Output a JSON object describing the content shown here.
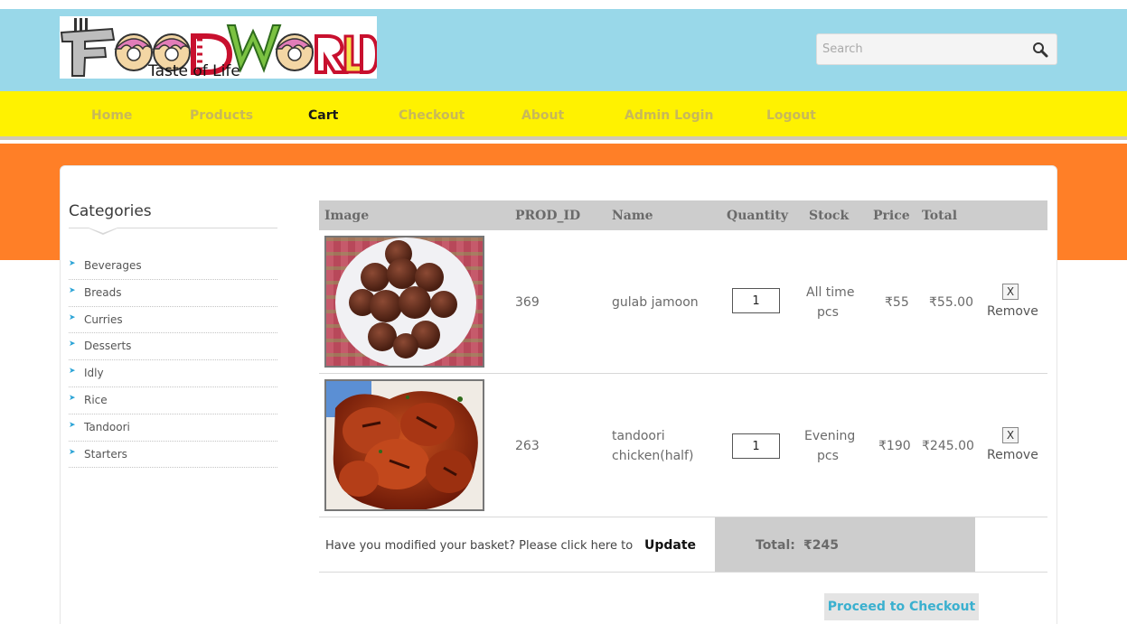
{
  "header": {
    "logo": {
      "brand": "FOODWORLD",
      "tagline": "Taste of Life"
    },
    "search": {
      "placeholder": "Search",
      "value": ""
    }
  },
  "nav": {
    "items": [
      "Home",
      "Products",
      "Cart",
      "Checkout",
      "About",
      "Admin Login",
      "Logout"
    ],
    "active": "Cart"
  },
  "sidebar": {
    "title": "Categories",
    "categories": [
      "Beverages",
      "Breads",
      "Curries",
      "Desserts",
      "Idly",
      "Rice",
      "Tandoori",
      "Starters"
    ]
  },
  "cart": {
    "columns": [
      "Image",
      "PROD_ID",
      "Name",
      "Quantity",
      "Stock",
      "Price",
      "Total"
    ],
    "rows": [
      {
        "prod_id": "369",
        "name": "gulab jamoon",
        "name_line2": "",
        "quantity": "1",
        "stock": "All time",
        "stock_unit": "pcs",
        "price": "₹55",
        "total": "₹55.00",
        "remove": "Remove",
        "remove_icon": "X"
      },
      {
        "prod_id": "263",
        "name": "tandoori",
        "name_line2": "chicken(half)",
        "quantity": "1",
        "stock": "Evening",
        "stock_unit": "pcs",
        "price": "₹190",
        "total": "₹245.00",
        "remove": "Remove",
        "remove_icon": "X"
      }
    ],
    "modified_text": "Have you modified your basket? Please click here to",
    "update_label": "Update",
    "total_label": "Total:",
    "total_value": "₹245",
    "checkout_label": "Proceed to Checkout"
  },
  "colors": {
    "header_bg": "#99d8e9",
    "nav_bg": "#fff200",
    "band_bg": "#ff7f27",
    "link_accent": "#3ab0cf"
  }
}
